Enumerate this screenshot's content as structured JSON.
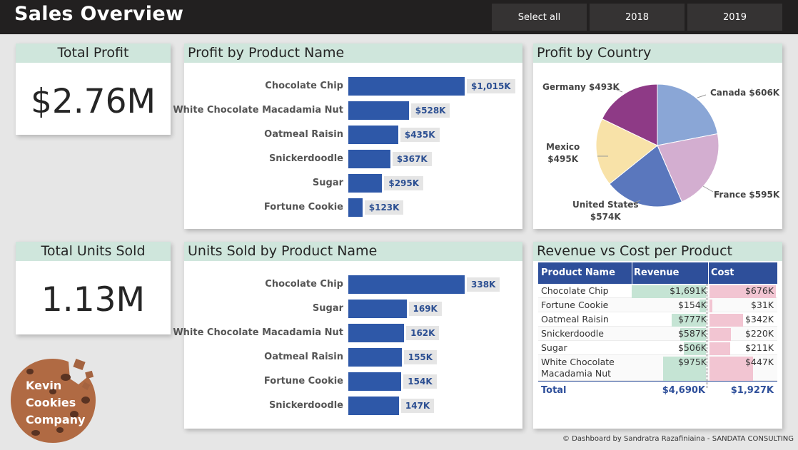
{
  "header": {
    "title": "Sales Overview",
    "slicers": [
      "Select all",
      "2018",
      "2019"
    ]
  },
  "kpis": {
    "total_profit": {
      "label": "Total Profit",
      "value": "$2.76M"
    },
    "total_units": {
      "label": "Total Units Sold",
      "value": "1.13M"
    }
  },
  "profit_by_product": {
    "title": "Profit by Product Name",
    "chart_data": {
      "type": "bar",
      "orientation": "horizontal",
      "categories": [
        "Chocolate Chip",
        "White Chocolate Macadamia Nut",
        "Oatmeal Raisin",
        "Snickerdoodle",
        "Sugar",
        "Fortune Cookie"
      ],
      "values": [
        1015,
        528,
        435,
        367,
        295,
        123
      ],
      "value_labels": [
        "$1,015K",
        "$528K",
        "$435K",
        "$367K",
        "$295K",
        "$123K"
      ],
      "max": 1015,
      "color": "#2e58a8"
    }
  },
  "units_by_product": {
    "title": "Units Sold by Product Name",
    "chart_data": {
      "type": "bar",
      "orientation": "horizontal",
      "categories": [
        "Chocolate Chip",
        "Sugar",
        "White Chocolate Macadamia Nut",
        "Oatmeal Raisin",
        "Fortune Cookie",
        "Snickerdoodle"
      ],
      "values": [
        338,
        169,
        162,
        155,
        154,
        147
      ],
      "value_labels": [
        "338K",
        "169K",
        "162K",
        "155K",
        "154K",
        "147K"
      ],
      "max": 338,
      "color": "#2e58a8"
    }
  },
  "profit_by_country": {
    "title": "Profit by Country",
    "chart_data": {
      "type": "pie",
      "categories": [
        "Canada",
        "France",
        "United States",
        "Mexico",
        "Germany"
      ],
      "values": [
        606,
        595,
        574,
        495,
        493
      ],
      "labels": [
        "Canada $606K",
        "France $595K",
        "United States $574K",
        "Mexico $495K",
        "Germany $493K"
      ],
      "colors": [
        "#8aa6d6",
        "#d3aed0",
        "#5a77bd",
        "#f8e2a8",
        "#8e3a86"
      ]
    }
  },
  "revenue_cost": {
    "title": "Revenue vs Cost per Product",
    "columns": [
      "Product Name",
      "Revenue",
      "Cost"
    ],
    "rows": [
      {
        "product": "Chocolate Chip",
        "revenue": "$1,691K",
        "cost": "$676K",
        "rev_num": 1691,
        "cost_num": 676
      },
      {
        "product": "Fortune Cookie",
        "revenue": "$154K",
        "cost": "$31K",
        "rev_num": 154,
        "cost_num": 31
      },
      {
        "product": "Oatmeal Raisin",
        "revenue": "$777K",
        "cost": "$342K",
        "rev_num": 777,
        "cost_num": 342
      },
      {
        "product": "Snickerdoodle",
        "revenue": "$587K",
        "cost": "$220K",
        "rev_num": 587,
        "cost_num": 220
      },
      {
        "product": "Sugar",
        "revenue": "$506K",
        "cost": "$211K",
        "rev_num": 506,
        "cost_num": 211
      },
      {
        "product": "White Chocolate Macadamia Nut",
        "product_line1": "White Chocolate",
        "product_line2": "Macadamia Nut",
        "revenue": "$975K",
        "cost": "$447K",
        "rev_num": 975,
        "cost_num": 447
      }
    ],
    "total_label": "Total",
    "total_revenue": "$4,690K",
    "total_cost": "$1,927K"
  },
  "logo": {
    "line1": "Kevin",
    "line2": "Cookies",
    "line3": "Company"
  },
  "footer": "© Dashboard by Sandratra Razafiniaina - SANDATA CONSULTING"
}
